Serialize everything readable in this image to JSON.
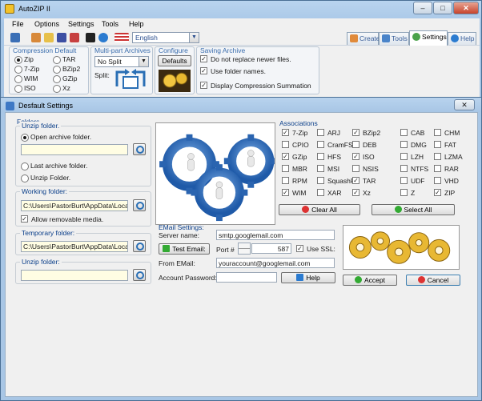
{
  "window": {
    "title": "AutoZIP II"
  },
  "menu": [
    "File",
    "Options",
    "Settings",
    "Tools",
    "Help"
  ],
  "toolbar": {
    "language": "English"
  },
  "tabs": [
    {
      "label": "Create",
      "active": false
    },
    {
      "label": "Tools",
      "active": false
    },
    {
      "label": "Settings",
      "active": true
    },
    {
      "label": "Help",
      "active": false
    }
  ],
  "ribbon": {
    "compression_default": {
      "label": "Compression Default",
      "options": [
        "Zip",
        "TAR",
        "7-Zip",
        "BZip2",
        "WIM",
        "GZip",
        "ISO",
        "Xz"
      ],
      "selected": "Zip"
    },
    "multipart": {
      "label": "Multi-part Archives",
      "value": "No Split",
      "split_label": "Split:"
    },
    "configure": {
      "label": "Configure",
      "button": "Defaults"
    },
    "saving": {
      "label": "Saving Archive",
      "options": [
        {
          "label": "Do not replace newer files.",
          "checked": true
        },
        {
          "label": "Use folder names.",
          "checked": true
        },
        {
          "label": "Display Compression Summation",
          "checked": true
        }
      ]
    }
  },
  "dialog": {
    "title": "Desfault Settings",
    "folders": {
      "label": "Folders",
      "unzip_group": "Unzip folder.",
      "open_archive": "Open archive folder.",
      "last_archive": "Last archive folder.",
      "unzip_folder": "Unzip Folder.",
      "unzip_selected": "Open archive folder.",
      "unzip_path": "",
      "working_label": "Working folder:",
      "working_path": "C:\\Users\\PastorBurt\\AppData\\Local\\Au",
      "allow_removable": "Allow removable media.",
      "allow_removable_checked": true,
      "temp_label": "Temporary folder:",
      "temp_path": "C:\\Users\\PastorBurt\\AppData\\Local\\Au",
      "unzip2_label": "Unzip folder:",
      "unzip2_path": ""
    },
    "associations": {
      "label": "Associations",
      "items": [
        {
          "label": "7-Zip",
          "checked": true
        },
        {
          "label": "ARJ",
          "checked": false
        },
        {
          "label": "BZip2",
          "checked": true
        },
        {
          "label": "CAB",
          "checked": false
        },
        {
          "label": "CHM",
          "checked": false
        },
        {
          "label": "CPIO",
          "checked": false
        },
        {
          "label": "CramFS",
          "checked": false
        },
        {
          "label": "DEB",
          "checked": false
        },
        {
          "label": "DMG",
          "checked": false
        },
        {
          "label": "FAT",
          "checked": false
        },
        {
          "label": "GZip",
          "checked": true
        },
        {
          "label": "HFS",
          "checked": false
        },
        {
          "label": "ISO",
          "checked": true
        },
        {
          "label": "LZH",
          "checked": false
        },
        {
          "label": "LZMA",
          "checked": false
        },
        {
          "label": "MBR",
          "checked": false
        },
        {
          "label": "MSI",
          "checked": false
        },
        {
          "label": "NSIS",
          "checked": false
        },
        {
          "label": "NTFS",
          "checked": false
        },
        {
          "label": "RAR",
          "checked": false
        },
        {
          "label": "RPM",
          "checked": false
        },
        {
          "label": "SquashFS",
          "checked": false
        },
        {
          "label": "TAR",
          "checked": true
        },
        {
          "label": "UDF",
          "checked": false
        },
        {
          "label": "VHD",
          "checked": false
        },
        {
          "label": "WIM",
          "checked": true
        },
        {
          "label": "XAR",
          "checked": false
        },
        {
          "label": "Xz",
          "checked": true
        },
        {
          "label": "Z",
          "checked": false
        },
        {
          "label": "ZIP",
          "checked": true
        }
      ],
      "clear_all": "Clear All",
      "select_all": "Select All"
    },
    "email": {
      "label": "EMail Settings:",
      "server_label": "Server name:",
      "server": "smtp.googlemail.com",
      "test_button": "Test Email:",
      "port_label": "Port #",
      "port": "587",
      "use_ssl": "Use SSL:",
      "use_ssl_checked": true,
      "from_label": "From EMail:",
      "from": "youraccount@googlemail.com",
      "password_label": "Account Password:",
      "password": "",
      "help_button": "Help"
    },
    "accept": "Accept",
    "cancel": "Cancel"
  }
}
